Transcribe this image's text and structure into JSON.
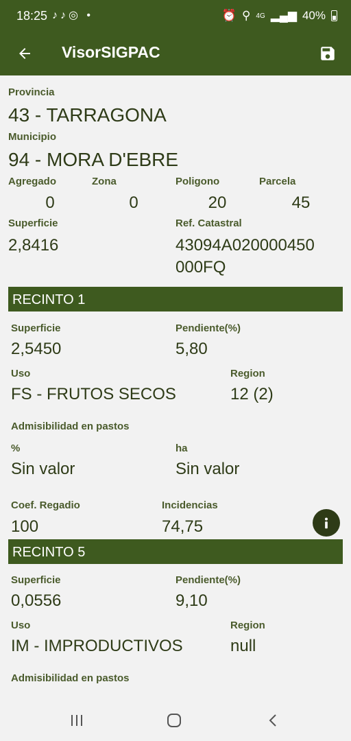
{
  "status": {
    "time": "18:25",
    "network": "4G",
    "battery": "40%"
  },
  "appbar": {
    "title": "VisorSIGPAC"
  },
  "parcel": {
    "provincia_label": "Provincia",
    "provincia_value": "43 - TARRAGONA",
    "municipio_label": "Municipio",
    "municipio_value": "94 - MORA D'EBRE",
    "agregado_label": "Agregado",
    "agregado_value": "0",
    "zona_label": "Zona",
    "zona_value": "0",
    "poligono_label": "Poligono",
    "poligono_value": "20",
    "parcela_label": "Parcela",
    "parcela_value": "45",
    "superficie_label": "Superficie",
    "superficie_value": "2,8416",
    "ref_label": "Ref. Catastral",
    "ref_value_line1": "43094A020000450",
    "ref_value_line2": "000FQ"
  },
  "recinto1": {
    "header": "RECINTO 1",
    "superficie_label": "Superficie",
    "superficie_value": "2,5450",
    "pendiente_label": "Pendiente(%)",
    "pendiente_value": "5,80",
    "uso_label": "Uso",
    "uso_value": "FS - FRUTOS SECOS",
    "region_label": "Region",
    "region_value": "12 (2)",
    "admisibilidad_label": "Admisibilidad en pastos",
    "pct_label": "%",
    "pct_value": "Sin valor",
    "ha_label": "ha",
    "ha_value": "Sin valor",
    "coef_label": "Coef. Regadio",
    "coef_value": "100",
    "incidencias_label": "Incidencias",
    "incidencias_value": "74,75"
  },
  "recinto5": {
    "header": "RECINTO 5",
    "superficie_label": "Superficie",
    "superficie_value": "0,0556",
    "pendiente_label": "Pendiente(%)",
    "pendiente_value": "9,10",
    "uso_label": "Uso",
    "uso_value": "IM - IMPRODUCTIVOS",
    "region_label": "Region",
    "region_value": "null",
    "admisibilidad_label": "Admisibilidad en pastos"
  },
  "icons": {
    "back": "arrow-left-icon",
    "save": "save-icon",
    "info": "info-icon"
  }
}
